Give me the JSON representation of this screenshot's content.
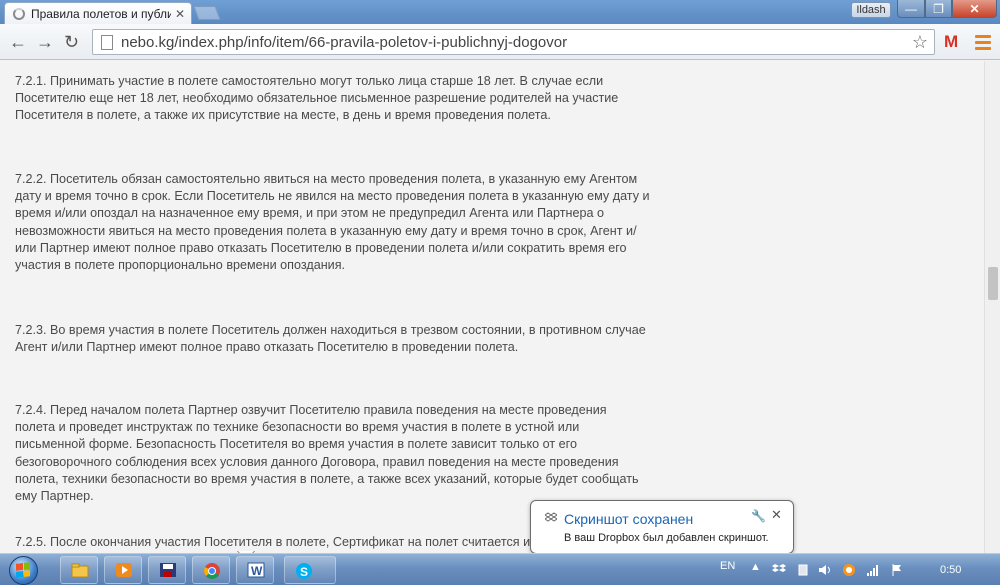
{
  "browser": {
    "tab_title": "Правила полетов и публи",
    "tab_close": "✕",
    "user_name": "Ildash",
    "url": "nebo.kg/index.php/info/item/66-pravila-poletov-i-publichnyj-dogovor",
    "min_glyph": "—",
    "max_glyph": "❐",
    "close_glyph": "✕",
    "back_glyph": "←",
    "forward_glyph": "→",
    "reload_glyph": "↻",
    "star_glyph": "☆",
    "gmail_glyph": "M"
  },
  "content": {
    "paragraphs": [
      "7.2.1. Принимать участие в полете самостоятельно могут только лица старше 18 лет. В случае если Посетителю еще нет 18 лет, необходимо обязательное письменное разрешение родителей на участие Посетителя в полете, а также их присутствие на месте, в день и время проведения полета.",
      "7.2.2. Посетитель обязан самостоятельно явиться на место проведения полета, в указанную ему Агентом дату и время точно в срок. Если Посетитель не явился на место проведения полета в указанную ему дату и время и/или опоздал на назначенное ему время, и при этом не предупредил Агента или Партнера о невозможности явиться на место проведения полета в указанную ему дату и время точно в срок, Агент и/или Партнер имеют полное право отказать Посетителю в проведении полета и/или сократить время его участия в полете пропорционально времени опоздания.",
      "7.2.3. Во время участия в полете Посетитель должен находиться в трезвом состоянии, в противном случае Агент и/или Партнер имеют полное право отказать Посетителю в проведении полета.",
      "7.2.4. Перед началом полета Партнер озвучит Посетителю правила поведения на месте проведения полета и проведет инструктаж по технике безопасности во время участия в полете в устной или письменной форме. Безопасность Посетителя во время участия в полете зависит только от его безоговорочного соблюдения всех условия данного Договора, правил поведения на месте проведения полета, техники безопасности во время участия в полете, а также всех указаний, которые будет сообщать ему Партнер.",
      "7.2.5. После окончания участия Посетителя в полете, Сертификат на полет считается использованным."
    ]
  },
  "notification": {
    "title": "Скриншот сохранен",
    "text": "В ваш Dropbox был добавлен скриншот.",
    "settings_glyph": "🔧",
    "close_glyph": "✕"
  },
  "taskbar": {
    "language": "EN",
    "clock": "0:50",
    "apps": [
      "explorer-icon",
      "media-player-icon",
      "save-icon",
      "chrome-icon",
      "word-icon",
      "skype-icon"
    ]
  },
  "colors": {
    "accent": "#1a64b4",
    "text": "#4a4a4a",
    "taskbar": "#6a8fbf",
    "menu": "#e8821a"
  }
}
